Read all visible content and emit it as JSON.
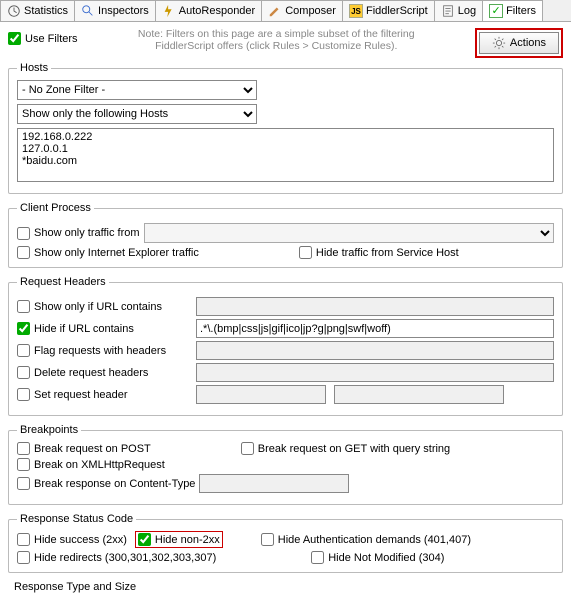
{
  "tabs": {
    "statistics": "Statistics",
    "inspectors": "Inspectors",
    "autoresponder": "AutoResponder",
    "composer": "Composer",
    "fiddlerscript": "FiddlerScript",
    "log": "Log",
    "filters": "Filters"
  },
  "useFilters": "Use Filters",
  "note1": "Note: Filters on this page are a simple subset of the filtering",
  "note2": "FiddlerScript offers (click Rules > Customize Rules).",
  "actions": "Actions",
  "hosts": {
    "legend": "Hosts",
    "zone": "- No Zone Filter -",
    "mode": "Show only the following Hosts",
    "text": "192.168.0.222\n127.0.0.1\n*baidu.com"
  },
  "clientProcess": {
    "legend": "Client Process",
    "showOnly": "Show only traffic from",
    "ieOnly": "Show only Internet Explorer traffic",
    "hideSvc": "Hide traffic from Service Host"
  },
  "requestHeaders": {
    "legend": "Request Headers",
    "showIfUrl": "Show only if URL contains",
    "hideIfUrl": "Hide if URL contains",
    "hideIfUrlVal": ".*\\.(bmp|css|js|gif|ico|jp?g|png|swf|woff)",
    "flag": "Flag requests with headers",
    "delete": "Delete request headers",
    "set": "Set request header"
  },
  "breakpoints": {
    "legend": "Breakpoints",
    "post": "Break request on POST",
    "getqs": "Break request on GET with query string",
    "xhr": "Break on XMLHttpRequest",
    "respCT": "Break response on Content-Type"
  },
  "status": {
    "legend": "Response Status Code",
    "hideSuccess": "Hide success (2xx)",
    "hideNon2xx": "Hide non-2xx",
    "hideAuth": "Hide Authentication demands (401,407)",
    "hideRedir": "Hide redirects (300,301,302,303,307)",
    "hideNotMod": "Hide Not Modified (304)"
  },
  "responseType": "Response Type and Size"
}
